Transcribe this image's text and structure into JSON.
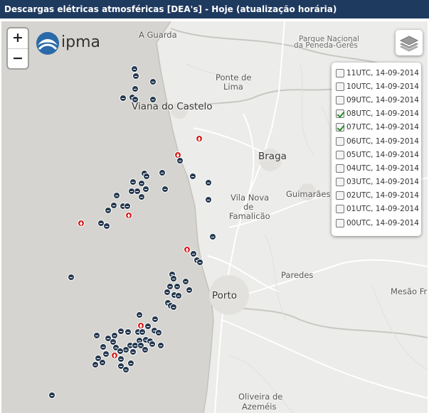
{
  "title": "Descargas elétricas atmosféricas [DEA's] - Hoje (atualização horária)",
  "zoom": {
    "in_label": "+",
    "out_label": "−"
  },
  "logo": {
    "text": "ipma"
  },
  "places": [
    {
      "key": "a_guarda",
      "name": "A Guarda",
      "size": "med"
    },
    {
      "key": "parque",
      "name": "Parque Nacional",
      "size": "small"
    },
    {
      "key": "peneda",
      "name": "da Peneda-Gerês",
      "size": "small"
    },
    {
      "key": "ponte_lima_1",
      "name": "Ponte de",
      "size": "med"
    },
    {
      "key": "ponte_lima_2",
      "name": "Lima",
      "size": "med"
    },
    {
      "key": "viana",
      "name": "Viana do Castelo",
      "size": "big"
    },
    {
      "key": "braga",
      "name": "Braga",
      "size": "big"
    },
    {
      "key": "vnf_1",
      "name": "Vila Nova",
      "size": "med"
    },
    {
      "key": "vnf_2",
      "name": "de",
      "size": "med"
    },
    {
      "key": "vnf_3",
      "name": "Famalicão",
      "size": "med"
    },
    {
      "key": "guimaraes",
      "name": "Guimarães",
      "size": "med"
    },
    {
      "key": "paredes",
      "name": "Paredes",
      "size": "med"
    },
    {
      "key": "porto",
      "name": "Porto",
      "size": "big"
    },
    {
      "key": "mesao",
      "name": "Mesão Fri",
      "size": "med"
    },
    {
      "key": "oliveira_1",
      "name": "Oliveira de",
      "size": "med"
    },
    {
      "key": "oliveira_2",
      "name": "Azeméis",
      "size": "med"
    }
  ],
  "layers": [
    {
      "label": "11UTC, 14-09-2014",
      "checked": false
    },
    {
      "label": "10UTC, 14-09-2014",
      "checked": false
    },
    {
      "label": "09UTC, 14-09-2014",
      "checked": false
    },
    {
      "label": "08UTC, 14-09-2014",
      "checked": true
    },
    {
      "label": "07UTC, 14-09-2014",
      "checked": true
    },
    {
      "label": "06UTC, 14-09-2014",
      "checked": false
    },
    {
      "label": "05UTC, 14-09-2014",
      "checked": false
    },
    {
      "label": "04UTC, 14-09-2014",
      "checked": false
    },
    {
      "label": "03UTC, 14-09-2014",
      "checked": false
    },
    {
      "label": "02UTC, 14-09-2014",
      "checked": false
    },
    {
      "label": "01UTC, 14-09-2014",
      "checked": false
    },
    {
      "label": "00UTC, 14-09-2014",
      "checked": false
    }
  ],
  "colors": {
    "negative_strike": "#24384f",
    "positive_strike": "#d62020",
    "title_bar": "#1f3a5f"
  }
}
